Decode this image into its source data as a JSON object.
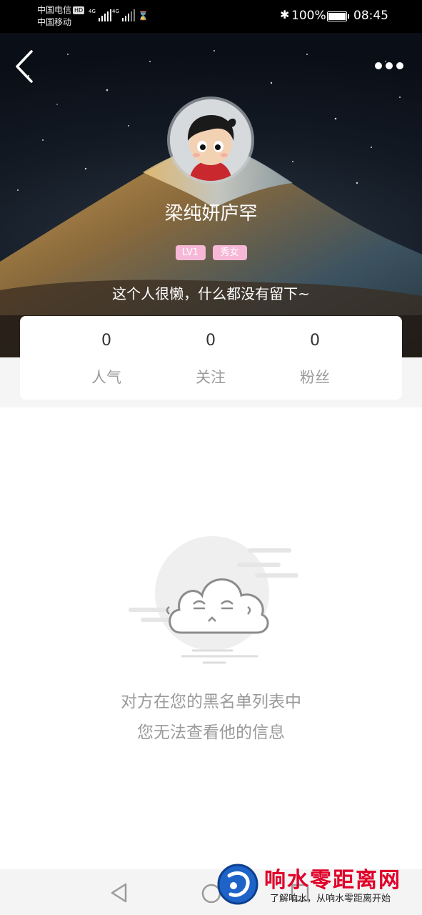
{
  "status_bar": {
    "carrier1": "中国电信",
    "carrier1_badge": "HD",
    "carrier2": "中国移动",
    "net1": "4G",
    "net2": "4G",
    "battery": "100%",
    "time": "08:45"
  },
  "profile": {
    "name": "梁纯妍庐罕",
    "level_tag": "LV1",
    "gender_tag": "秀女",
    "bio": "这个人很懒，什么都没有留下~",
    "stats": [
      {
        "value": "0",
        "label": "人气"
      },
      {
        "value": "0",
        "label": "关注"
      },
      {
        "value": "0",
        "label": "粉丝"
      }
    ]
  },
  "empty_state": {
    "line1": "对方在您的黑名单列表中",
    "line2": "您无法查看他的信息"
  },
  "watermark": {
    "title": "响水零距离网",
    "subtitle": "了解响水，从响水零距离开始"
  },
  "colors": {
    "tag_pink": "#f6b8d6",
    "muted_text": "#9a9a9a",
    "watermark_red": "#e0002a"
  }
}
